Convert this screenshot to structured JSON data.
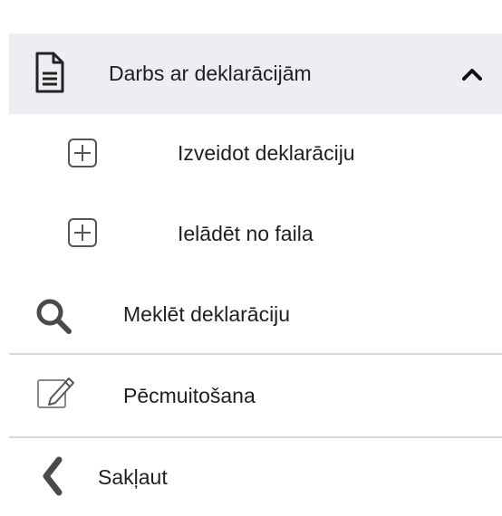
{
  "menu": {
    "work_with_declarations": "Darbs ar deklarācijām",
    "create_declaration": "Izveidot deklarāciju",
    "load_from_file": "Ielādēt no faila",
    "search_declaration": "Meklēt deklarāciju",
    "post_clearance": "Pēcmuitošana",
    "collapse": "Sakļaut"
  },
  "icons": {
    "header": "document-icon",
    "header_toggle": "chevron-up-icon",
    "create": "plus-box-icon",
    "load": "plus-box-icon",
    "search": "search-icon",
    "post_clearance": "edit-icon",
    "collapse": "chevron-left-icon"
  },
  "colors": {
    "header_bg": "#eceef2",
    "divider": "#d8d8d8",
    "icon": "#4a4a4a",
    "text": "#1f1f1f"
  }
}
